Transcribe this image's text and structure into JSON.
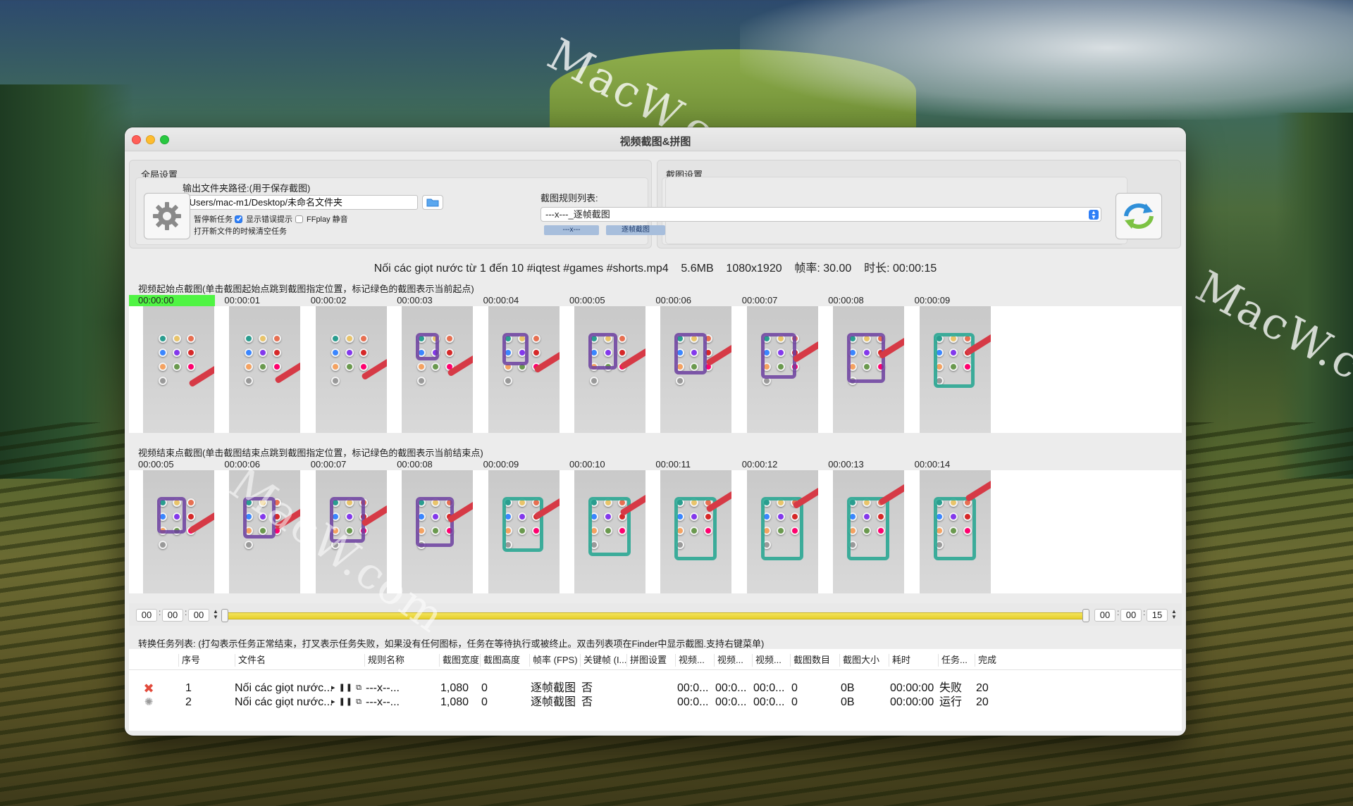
{
  "window": {
    "title": "视频截图&拼图"
  },
  "global_settings": {
    "group_label": "全局设置",
    "output_label": "输出文件夹路径:(用于保存截图)",
    "output_path": "/Users/mac-m1/Desktop/未命名文件夹",
    "checkboxes": [
      {
        "label": "暂停新任务",
        "checked": false
      },
      {
        "label": "显示错误提示",
        "checked": true
      },
      {
        "label": "FFplay 静音",
        "checked": false
      },
      {
        "label": "打开新文件的时候清空任务",
        "checked": true
      }
    ]
  },
  "capture_settings": {
    "group_label": "截图设置",
    "rule_list_label": "截图规则列表:",
    "selected_rule": "---x---_逐帧截图",
    "tags": [
      "---x---",
      "逐帧截图"
    ]
  },
  "file_info": {
    "name": "Nối các giọt nước từ 1 đến 10 #iqtest #games #shorts.mp4",
    "size": "5.6MB",
    "resolution": "1080x1920",
    "fps": "帧率: 30.00",
    "duration": "时长: 00:00:15"
  },
  "start_section": {
    "label": "视频起始点截图(单击截图起始点跳到截图指定位置，标记绿色的截图表示当前起点)",
    "times": [
      "00:00:00",
      "00:00:01",
      "00:00:02",
      "00:00:03",
      "00:00:04",
      "00:00:05",
      "00:00:06",
      "00:00:07",
      "00:00:08",
      "00:00:09"
    ]
  },
  "end_section": {
    "label": "视频结束点截图(单击截图结束点跳到截图指定位置，标记绿色的截图表示当前结束点)",
    "times": [
      "00:00:05",
      "00:00:06",
      "00:00:07",
      "00:00:08",
      "00:00:09",
      "00:00:10",
      "00:00:11",
      "00:00:12",
      "00:00:13",
      "00:00:14"
    ]
  },
  "range": {
    "start": [
      "00",
      "00",
      "00"
    ],
    "end": [
      "00",
      "00",
      "15"
    ]
  },
  "task_list": {
    "label": "转换任务列表: (打勾表示任务正常结束，打叉表示任务失败，如果没有任何图标，任务在等待执行或被终止。双击列表项在Finder中显示截图.支持右键菜单)",
    "columns": [
      "序号",
      "文件名",
      "规则名称",
      "截图宽度",
      "截图高度",
      "帧率 (FPS)",
      "关键帧 (I...",
      "拼图设置",
      "视频...",
      "视频...",
      "视频...",
      "截图数目",
      "截图大小",
      "耗时",
      "任务...",
      "完成"
    ],
    "rows": [
      {
        "index": "1",
        "file": "Nối các giọt nước...",
        "rule": "---x--...",
        "width": "1,080",
        "height": "0",
        "fps": "逐帧截图",
        "keyframe": "否",
        "v1": "00:0...",
        "v2": "00:0...",
        "v3": "00:0...",
        "count": "0",
        "size": "0B",
        "time": "00:00:00",
        "status": "失败",
        "done": "20",
        "state_icon": "cross-icon"
      },
      {
        "index": "2",
        "file": "Nối các giọt nước...",
        "rule": "---x--...",
        "width": "1,080",
        "height": "0",
        "fps": "逐帧截图",
        "keyframe": "否",
        "v1": "00:0...",
        "v2": "00:0...",
        "v3": "00:0...",
        "count": "0",
        "size": "0B",
        "time": "00:00:00",
        "status": "运行",
        "done": "20",
        "state_icon": "spinner-icon"
      }
    ],
    "mini_controls": "▸ ❚❚ ⧉"
  },
  "watermarks": [
    "MacW.com",
    "MacW.com",
    "MacW.com"
  ]
}
